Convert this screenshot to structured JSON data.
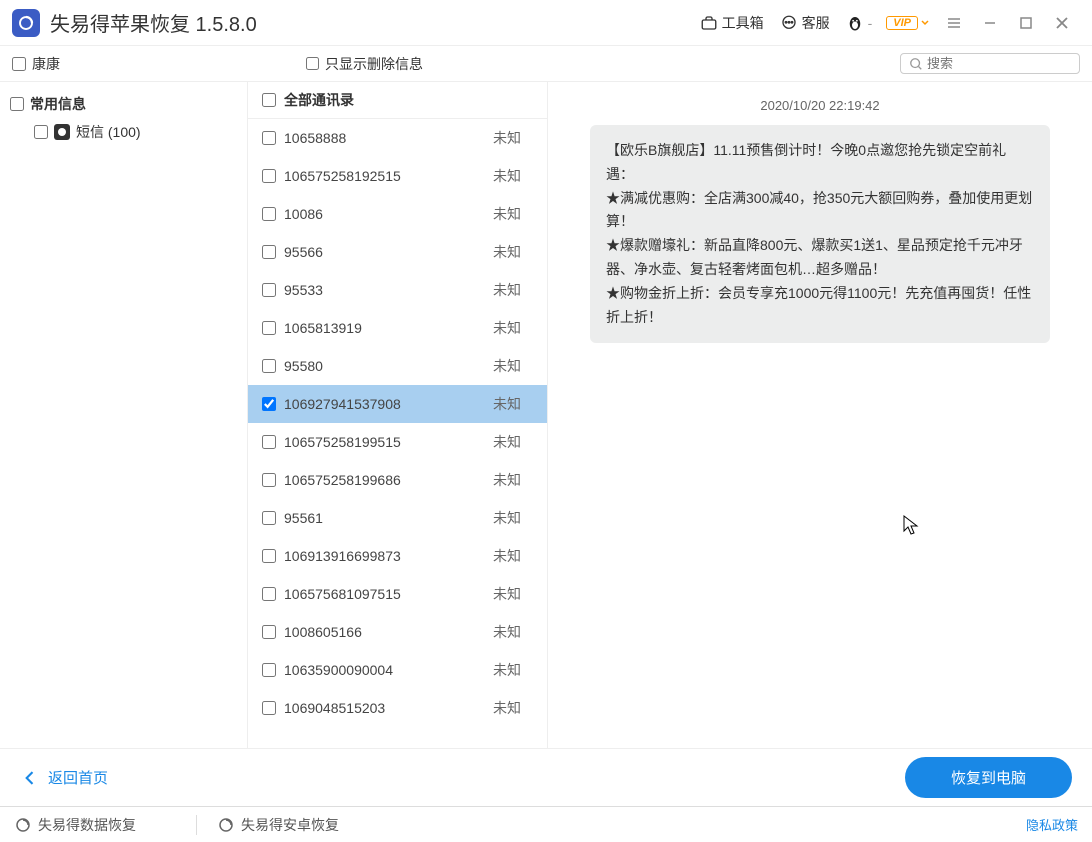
{
  "header": {
    "title": "失易得苹果恢复  1.5.8.0",
    "toolbox": "工具箱",
    "support": "客服",
    "vip": "VIP"
  },
  "filter": {
    "name_check": "康康",
    "deleted_only": "只显示删除信息",
    "search_placeholder": "搜索"
  },
  "tree": {
    "root": "常用信息",
    "sms": "短信 (100)"
  },
  "list": {
    "header": "全部通讯录",
    "unknown": "未知",
    "rows": [
      {
        "num": "10658888",
        "checked": false
      },
      {
        "num": "106575258192515",
        "checked": false
      },
      {
        "num": "10086",
        "checked": false
      },
      {
        "num": "95566",
        "checked": false
      },
      {
        "num": "95533",
        "checked": false
      },
      {
        "num": "1065813919",
        "checked": false
      },
      {
        "num": "95580",
        "checked": false
      },
      {
        "num": "106927941537908",
        "checked": true,
        "selected": true
      },
      {
        "num": "106575258199515",
        "checked": false
      },
      {
        "num": "106575258199686",
        "checked": false
      },
      {
        "num": "95561",
        "checked": false
      },
      {
        "num": "106913916699873",
        "checked": false
      },
      {
        "num": "106575681097515",
        "checked": false
      },
      {
        "num": "1008605166",
        "checked": false
      },
      {
        "num": "10635900090004",
        "checked": false
      },
      {
        "num": "1069048515203",
        "checked": false
      }
    ]
  },
  "detail": {
    "time": "2020/10/20 22:19:42",
    "message": "【欧乐B旗舰店】11.11预售倒计时！今晚0点邀您抢先锁定空前礼遇：\n★满减优惠购：全店满300减40，抢350元大额回购券，叠加使用更划算！\n★爆款赠壕礼：新品直降800元、爆款买1送1、星品预定抢千元冲牙器、净水壶、复古轻奢烤面包机…超多赠品！\n★购物金折上折：会员专享充1000元得1100元！先充值再囤货！任性折上折！"
  },
  "footer": {
    "back": "返回首页",
    "recover": "恢复到电脑"
  },
  "bottom": {
    "data_recovery": "失易得数据恢复",
    "android_recovery": "失易得安卓恢复",
    "privacy": "隐私政策"
  }
}
